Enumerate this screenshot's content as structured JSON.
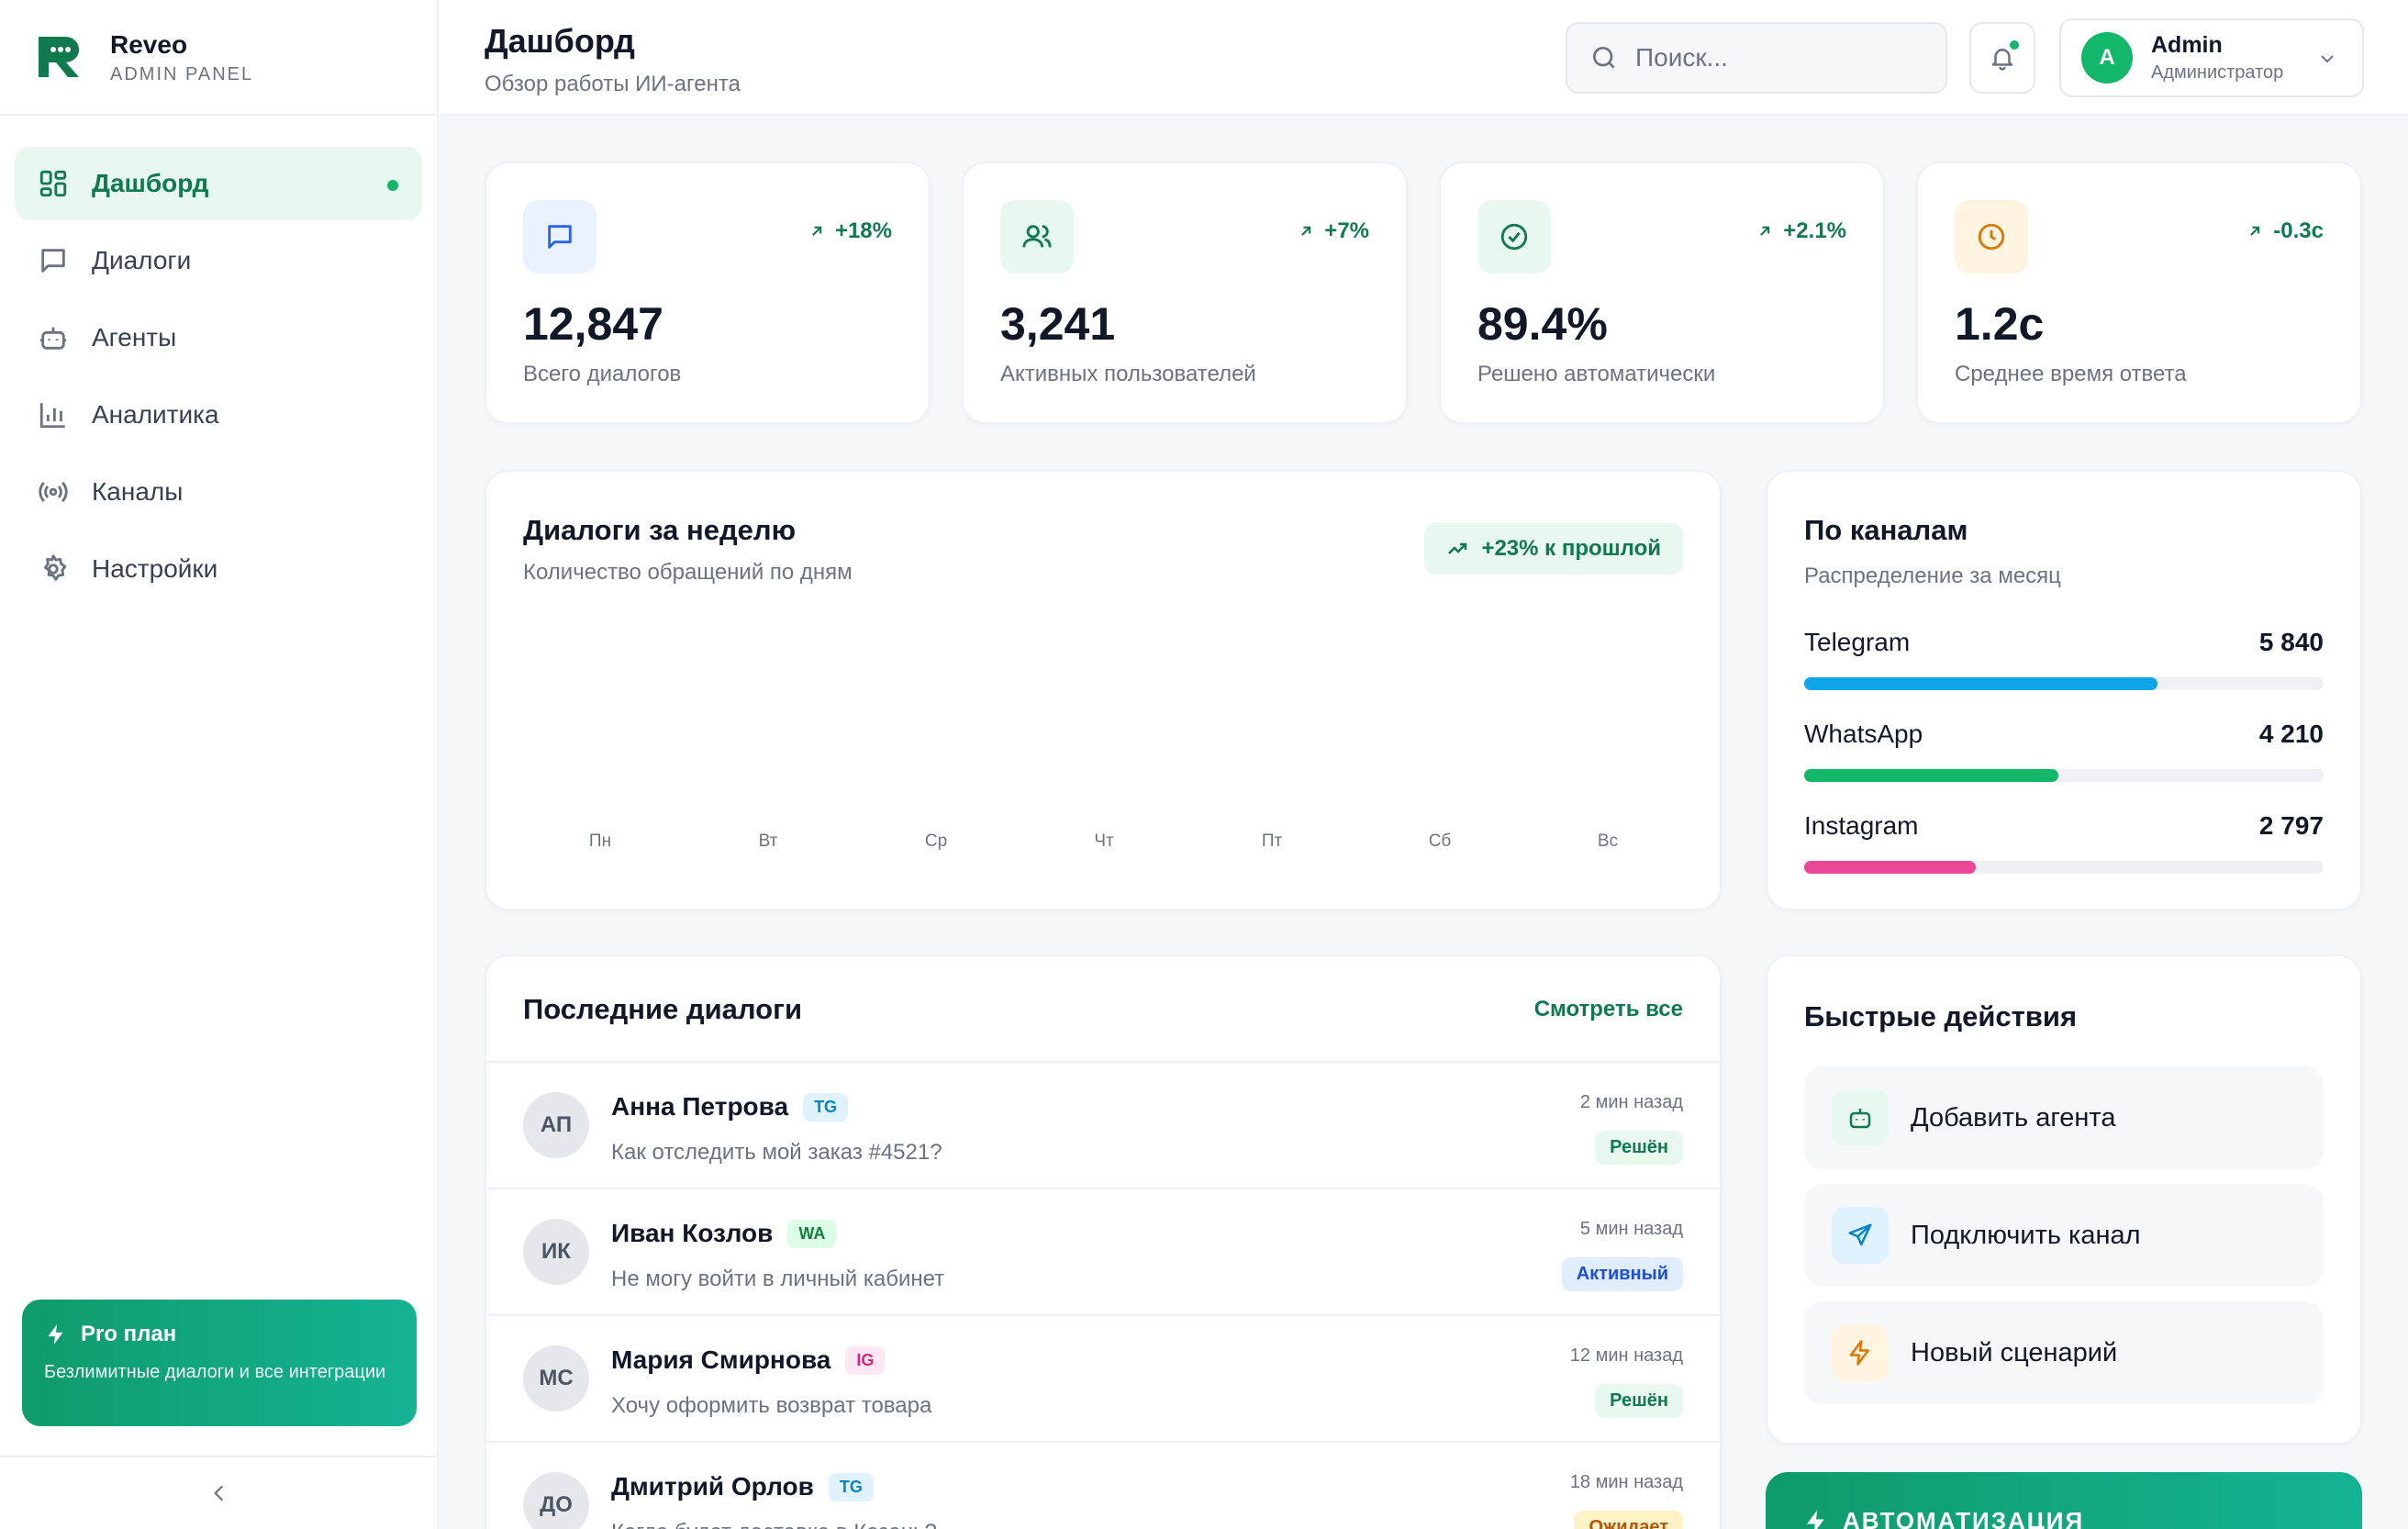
{
  "brand": {
    "name": "Reveo",
    "subtitle": "ADMIN PANEL"
  },
  "sidebar": {
    "items": [
      {
        "label": "Дашборд",
        "icon": "dashboard-grid-icon",
        "active": true
      },
      {
        "label": "Диалоги",
        "icon": "chat-bubble-icon"
      },
      {
        "label": "Агенты",
        "icon": "robot-icon"
      },
      {
        "label": "Аналитика",
        "icon": "bar-chart-icon"
      },
      {
        "label": "Каналы",
        "icon": "broadcast-icon"
      },
      {
        "label": "Настройки",
        "icon": "gear-icon"
      }
    ],
    "pro": {
      "title": "Pro план",
      "description": "Безлимитные диалоги и все интеграции"
    }
  },
  "header": {
    "title": "Дашборд",
    "subtitle": "Обзор работы ИИ-агента",
    "search_placeholder": "Поиск...",
    "user": {
      "initial": "A",
      "name": "Admin",
      "role": "Администратор"
    }
  },
  "stats": [
    {
      "value": "12,847",
      "label": "Всего диалогов",
      "change": "+18%",
      "icon": "chat-bubble-icon"
    },
    {
      "value": "3,241",
      "label": "Активных пользователей",
      "change": "+7%",
      "icon": "users-icon"
    },
    {
      "value": "89.4%",
      "label": "Решено автоматически",
      "change": "+2.1%",
      "icon": "check-circle-icon"
    },
    {
      "value": "1.2с",
      "label": "Среднее время ответа",
      "change": "-0.3с",
      "icon": "clock-icon"
    }
  ],
  "weekly": {
    "title": "Диалоги за неделю",
    "subtitle": "Количество обращений по дням",
    "trend": "+23% к прошлой",
    "days": [
      "Пн",
      "Вт",
      "Ср",
      "Чт",
      "Пт",
      "Сб",
      "Вс"
    ]
  },
  "channels": {
    "title": "По каналам",
    "subtitle": "Распределение за месяц",
    "items": [
      {
        "name": "Telegram",
        "value": "5 840",
        "share": 0.68,
        "color": "#0ea5e9"
      },
      {
        "name": "WhatsApp",
        "value": "4 210",
        "share": 0.49,
        "color": "#12b76a"
      },
      {
        "name": "Instagram",
        "value": "2 797",
        "share": 0.33,
        "color": "#ec4899"
      }
    ]
  },
  "dialogs": {
    "title": "Последние диалоги",
    "view_all": "Смотреть все",
    "rows": [
      {
        "initials": "АП",
        "name": "Анна Петрова",
        "tag": "TG",
        "message": "Как отследить мой заказ #4521?",
        "time": "2 мин назад",
        "status": "Решён"
      },
      {
        "initials": "ИК",
        "name": "Иван Козлов",
        "tag": "WA",
        "message": "Не могу войти в личный кабинет",
        "time": "5 мин назад",
        "status": "Активный"
      },
      {
        "initials": "МС",
        "name": "Мария Смирнова",
        "tag": "IG",
        "message": "Хочу оформить возврат товара",
        "time": "12 мин назад",
        "status": "Решён"
      },
      {
        "initials": "ДО",
        "name": "Дмитрий Орлов",
        "tag": "TG",
        "message": "Когда будет доставка в Казань?",
        "time": "18 мин назад",
        "status": "Ожидает"
      }
    ]
  },
  "quick_actions": {
    "title": "Быстрые действия",
    "items": [
      {
        "label": "Добавить агента",
        "icon": "robot-icon"
      },
      {
        "label": "Подключить канал",
        "icon": "send-icon"
      },
      {
        "label": "Новый сценарий",
        "icon": "lightning-icon"
      }
    ]
  },
  "automation": {
    "title": "АВТОМАТИЗАЦИЯ"
  },
  "colors": {
    "brand_green": "#12b76a",
    "brand_dark_green": "#0f7a4e",
    "telegram": "#0ea5e9",
    "whatsapp": "#12b76a",
    "instagram": "#ec4899"
  }
}
